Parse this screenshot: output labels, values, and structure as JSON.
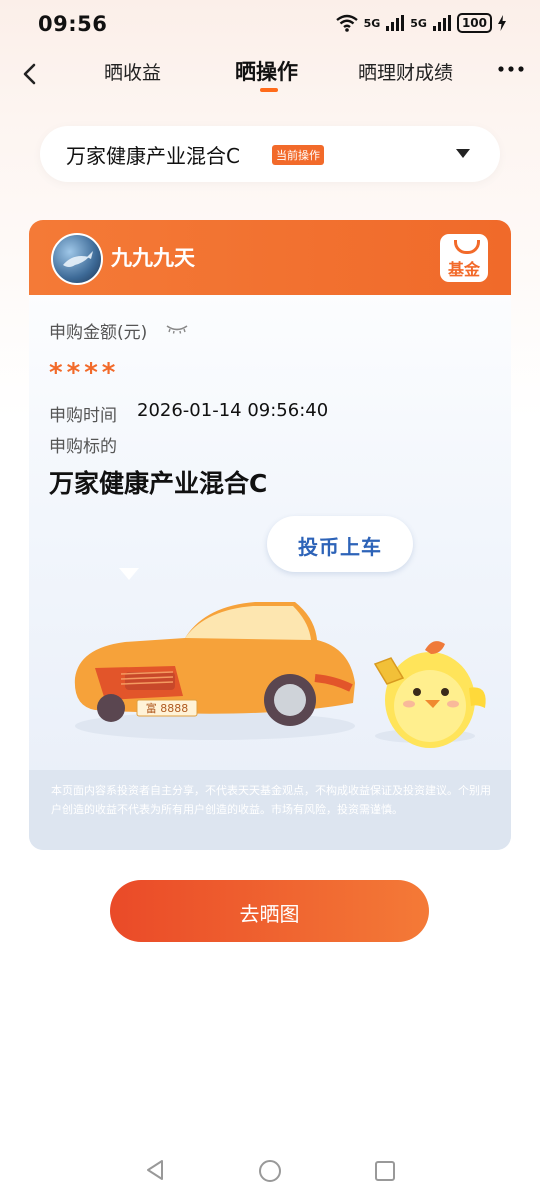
{
  "status_bar": {
    "time": "09:56",
    "net1": "5G",
    "net2": "5G",
    "battery": "100"
  },
  "nav": {
    "tabs": [
      {
        "label": "晒收益",
        "active": false
      },
      {
        "label": "晒操作",
        "active": true
      },
      {
        "label": "晒理财成绩",
        "active": false
      }
    ]
  },
  "selector": {
    "fund_name": "万家健康产业混合C",
    "badge": "当前操作"
  },
  "card": {
    "username": "九九九天",
    "logo_text": "基金",
    "amount_label": "申购金额(元)",
    "amount_masked": "****",
    "time_label": "申购时间",
    "time_value": "2026-01-14 09:56:40",
    "target_label": "申购标的",
    "target_value": "万家健康产业混合C",
    "bubble": "投币上车",
    "plate": "富 8888",
    "disclaimer": "本页面内容系投资者自主分享，不代表天天基金观点，不构成收益保证及投资建议。个别用户创造的收益不代表为所有用户创造的收益。市场有风险，投资需谨慎。"
  },
  "cta": {
    "label": "去晒图"
  },
  "colors": {
    "accent": "#f26a2a",
    "bubble_text": "#2d63b8"
  }
}
